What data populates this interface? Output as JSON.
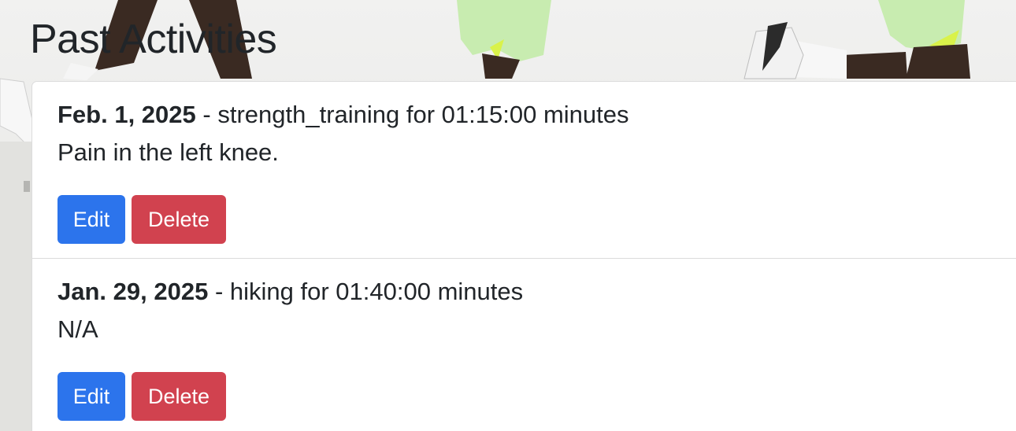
{
  "page": {
    "title": "Past Activities"
  },
  "colors": {
    "edit_button": "#2c74ec",
    "delete_button": "#d1424f"
  },
  "activities": [
    {
      "date": "Feb. 1, 2025",
      "summary": "- strength_training for 01:15:00 minutes",
      "notes": "Pain in the left knee.",
      "edit_label": "Edit",
      "delete_label": "Delete"
    },
    {
      "date": "Jan. 29, 2025",
      "summary": "- hiking for 01:40:00 minutes",
      "notes": "N/A",
      "edit_label": "Edit",
      "delete_label": "Delete"
    }
  ]
}
